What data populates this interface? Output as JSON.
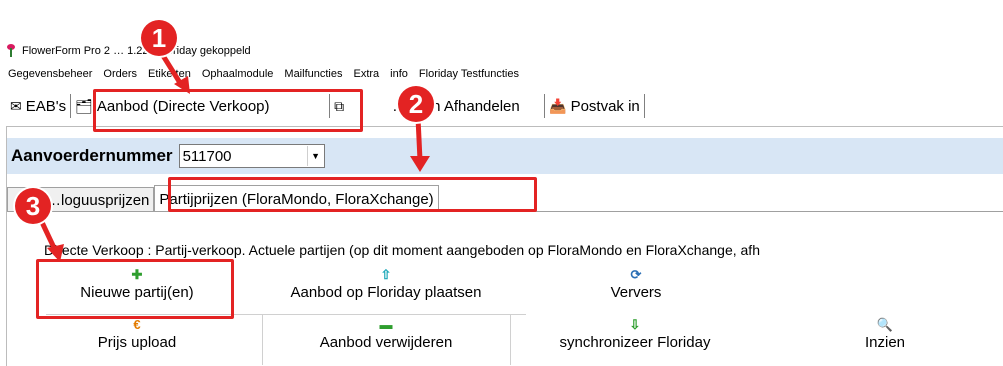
{
  "window": {
    "title": "FlowerForm Pro 2 … 1.229 Floriday gekoppeld"
  },
  "menu": [
    "Gegevensbeheer",
    "Orders",
    "Etiketten",
    "Ophaalmodule",
    "Mailfuncties",
    "Extra",
    "info",
    "Floriday Testfuncties"
  ],
  "tabs": [
    {
      "label": "EAB's",
      "icon": "envelope-icon"
    },
    {
      "label": "Aanbod (Directe Verkoop)",
      "icon": "offer-icon"
    },
    {
      "label": "…ngen Afhandelen",
      "icon": "copy-icon"
    },
    {
      "label": "Postvak in",
      "icon": "inbox-icon"
    }
  ],
  "supplier": {
    "label": "Aanvoerdernummer",
    "value": "511700"
  },
  "subtabs": [
    {
      "label": "…loguusprijzen"
    },
    {
      "label": "Partijprijzen (FloraMondo, FloraXchange)"
    }
  ],
  "description": "Directe Verkoop : Partij-verkoop. Actuele partijen (op dit moment aangeboden op FloraMondo en FloraXchange, afh",
  "actions": {
    "new_lot": {
      "label": "Nieuwe partij(en)",
      "icon": "plus-icon",
      "color": "#2e9e2e"
    },
    "place_offer": {
      "label": "Aanbod op Floriday plaatsen",
      "icon": "arrow-up-icon",
      "color": "#1aa7b8"
    },
    "refresh": {
      "label": "Ververs",
      "icon": "refresh-icon",
      "color": "#2b6fb5"
    },
    "price_upload": {
      "label": "Prijs upload",
      "icon": "euro-icon",
      "color": "#e37b00"
    },
    "remove_offer": {
      "label": "Aanbod verwijderen",
      "icon": "minus-icon",
      "color": "#2e9e2e"
    },
    "sync": {
      "label": "synchronizeer Floriday",
      "icon": "arrow-down-icon",
      "color": "#2e9e2e"
    },
    "view": {
      "label": "Inzien",
      "icon": "preview-icon",
      "color": "#444444"
    }
  },
  "annotations": [
    {
      "number": "1"
    },
    {
      "number": "2"
    },
    {
      "number": "3"
    }
  ],
  "colors": {
    "accent_red": "#e32323",
    "supplier_bar": "#d8e6f5"
  }
}
